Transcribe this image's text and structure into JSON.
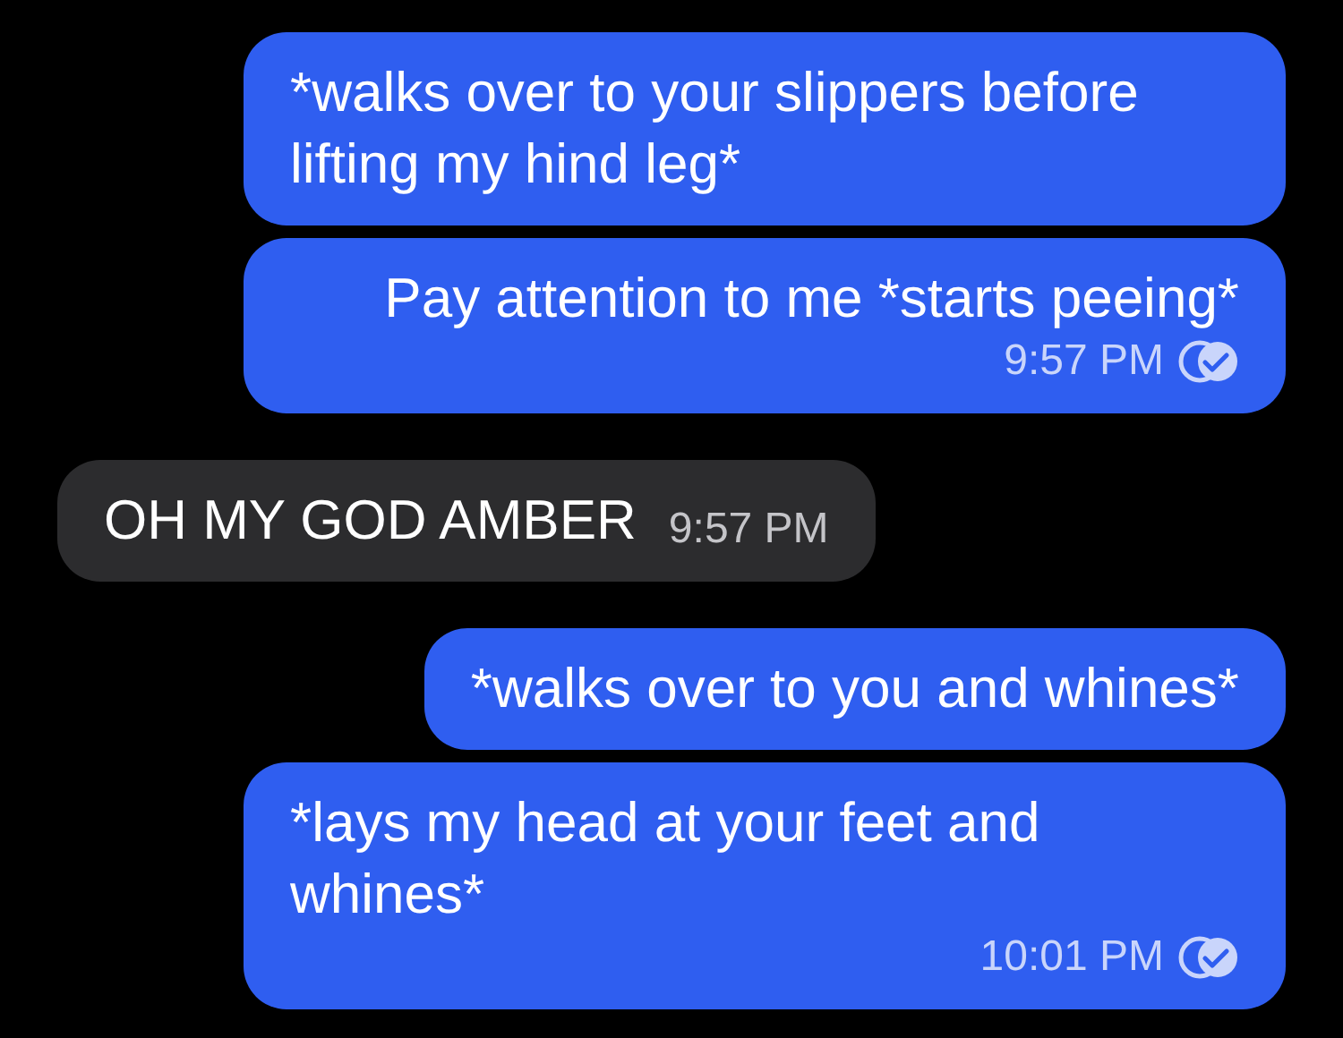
{
  "messages": [
    {
      "kind": "outgoing",
      "text": "*walks over to your slippers before lifting my hind leg*"
    },
    {
      "kind": "outgoing",
      "text": "Pay attention to me *starts peeing*",
      "time": "9:57 PM",
      "read": true
    },
    {
      "kind": "incoming",
      "text": "OH MY GOD AMBER",
      "time": "9:57 PM"
    },
    {
      "kind": "outgoing",
      "text": "*walks over to you and whines*"
    },
    {
      "kind": "outgoing",
      "text": "*lays my head at your feet and whines*",
      "time": "10:01 PM",
      "read": true
    }
  ]
}
